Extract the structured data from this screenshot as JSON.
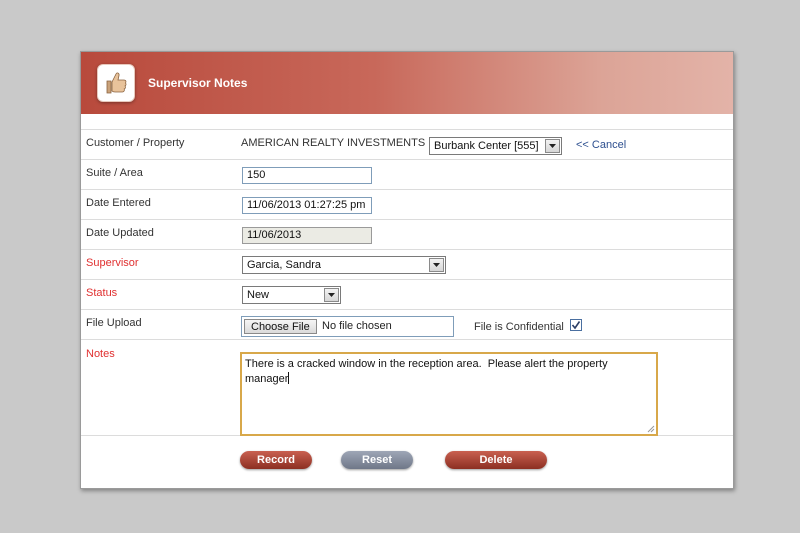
{
  "header": {
    "title": "Supervisor Notes",
    "logo_icon": "thumbs-up-icon"
  },
  "form": {
    "customer_property": {
      "label": "Customer / Property",
      "customer": "AMERICAN REALTY INVESTMENTS",
      "property_selected": "Burbank Center [555]",
      "cancel_link": "<< Cancel"
    },
    "suite_area": {
      "label": "Suite / Area",
      "value": "150"
    },
    "date_entered": {
      "label": "Date Entered",
      "value": "11/06/2013 01:27:25 pm"
    },
    "date_updated": {
      "label": "Date Updated",
      "value": "11/06/2013"
    },
    "supervisor": {
      "label": "Supervisor",
      "selected": "Garcia, Sandra"
    },
    "status": {
      "label": "Status",
      "selected": "New"
    },
    "file_upload": {
      "label": "File Upload",
      "button_label": "Choose File",
      "status_text": "No file chosen",
      "confidential_label": "File is Confidential",
      "confidential_checked": true
    },
    "notes": {
      "label": "Notes",
      "value": "There is a cracked window in the reception area.  Please alert the property manager"
    }
  },
  "actions": {
    "record_label": "Record",
    "reset_label": "Reset",
    "delete_label": "Delete"
  },
  "colors": {
    "header_start": "#b84a3c",
    "header_end": "#e3b3a8",
    "required_label": "#e03030",
    "link": "#2d4f8f",
    "button_red": "#8c2f22",
    "button_gray": "#6f7788"
  }
}
